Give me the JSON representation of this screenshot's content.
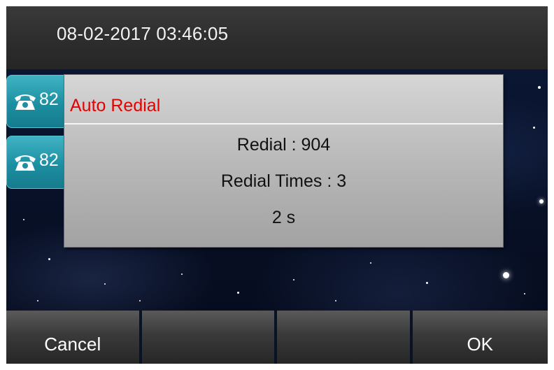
{
  "status_bar": {
    "datetime": "08-02-2017 03:46:05"
  },
  "line_keys": [
    {
      "icon": "phone-icon",
      "label": "82"
    },
    {
      "icon": "phone-icon",
      "label": "82"
    }
  ],
  "dialog": {
    "title": "Auto Redial",
    "title_color": "#e60000",
    "redial_number": "Redial : 904",
    "redial_times": "Redial Times : 3",
    "countdown": "2 s"
  },
  "softkeys": {
    "key1": "Cancel",
    "key2": "",
    "key3": "",
    "key4": "OK"
  }
}
